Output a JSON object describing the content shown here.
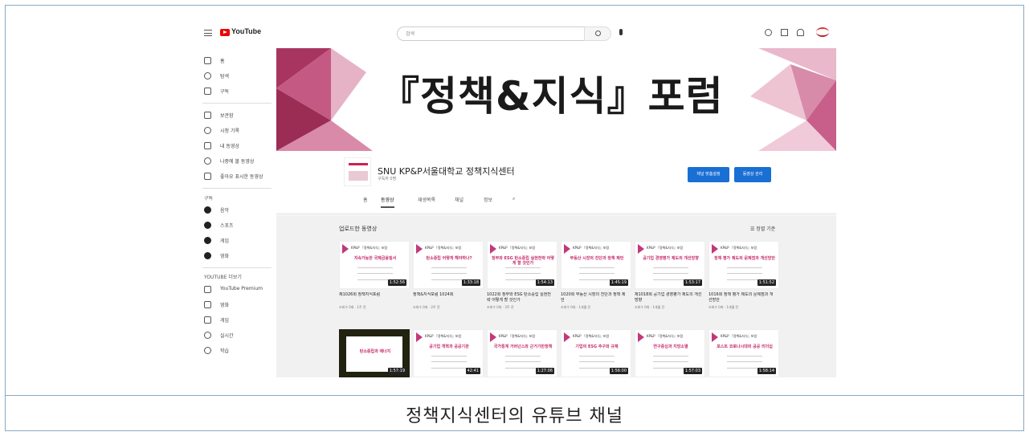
{
  "caption": "정책지식센터의 유튜브 채널",
  "youtube": {
    "logo_text": "YouTube",
    "search_placeholder": "검색",
    "banner_title": "『정책&지식』포럼",
    "channel_name": "SNU KP&P서울대학교 정책지식센터",
    "channel_sub": "구독자 0명",
    "buttons": {
      "customize": "채널 맞춤설정",
      "manage": "동영상 관리"
    },
    "tabs": [
      "홈",
      "동영상",
      "재생목록",
      "채널",
      "정보"
    ],
    "section_title": "업로드한 동영상",
    "sort_label": "정렬 기준",
    "sidebar": {
      "main": [
        "홈",
        "탐색",
        "구독"
      ],
      "library": [
        "보관함",
        "시청 기록",
        "내 동영상",
        "나중에 볼 동영상",
        "좋아요 표시한 동영상"
      ],
      "subs_header": "구독",
      "subs": [
        "음악",
        "스포츠",
        "게임",
        "영화"
      ],
      "more_header": "YOUTUBE 더보기",
      "more": [
        "YouTube Premium",
        "영화",
        "게임",
        "실시간",
        "학습"
      ]
    },
    "brand_small": "KP&P 『정책&지식』포럼",
    "videos_row1": [
      {
        "thumb_title": "지속가능한 국제금융질서",
        "duration": "1:52:56",
        "title": "제1026회 정책지식포럼",
        "meta": "조회수 0회 · 1주 전"
      },
      {
        "thumb_title": "탄소중립 어떻게 해야하나?",
        "duration": "1:33:18",
        "title": "정책&지식포럼 1024회",
        "meta": "조회수 0회 · 2주 전"
      },
      {
        "thumb_title": "정부와 ESG 탄소중립 실현전략 어떻게 할 것인가",
        "duration": "1:54:13",
        "title": "1022회 정부와 ESG 탄소중립 실현전략 어떻게 할 것인가",
        "meta": "조회수 0회 · 3주 전"
      },
      {
        "thumb_title": "부동산 시장의 진단과 정책 제언",
        "duration": "1:45:19",
        "title": "1020회 부동산 시장의 진단과 정책 제언",
        "meta": "조회수 0회 · 1개월 전"
      },
      {
        "thumb_title": "공기업 경영평가 제도의 개선방향",
        "duration": "1:53:17",
        "title": "제1018회 공기업 경영평가 제도의 개선방향",
        "meta": "조회수 0회 · 1개월 전"
      },
      {
        "thumb_title": "정책 평가 제도의 문제점과 개선방안",
        "duration": "1:51:52",
        "title": "1016회 정책 평가 제도의 문제점과 개선방안",
        "meta": "조회수 0회 · 1개월 전"
      }
    ],
    "videos_row2": [
      {
        "thumb_title": "탄소중립과 에너지",
        "duration": "1:57:19"
      },
      {
        "thumb_title": "공기업 개혁과 공공기관",
        "duration": "42:41"
      },
      {
        "thumb_title": "국가통계 거버넌스와 근거기반정책",
        "duration": "1:27:06"
      },
      {
        "thumb_title": "기업의 ESG 추구와 규제",
        "duration": "1:56:00"
      },
      {
        "thumb_title": "연구중심과 지방소멸",
        "duration": "1:57:03"
      },
      {
        "thumb_title": "포스트 코로나시대의 공공 리더십",
        "duration": "1:58:14"
      }
    ]
  }
}
